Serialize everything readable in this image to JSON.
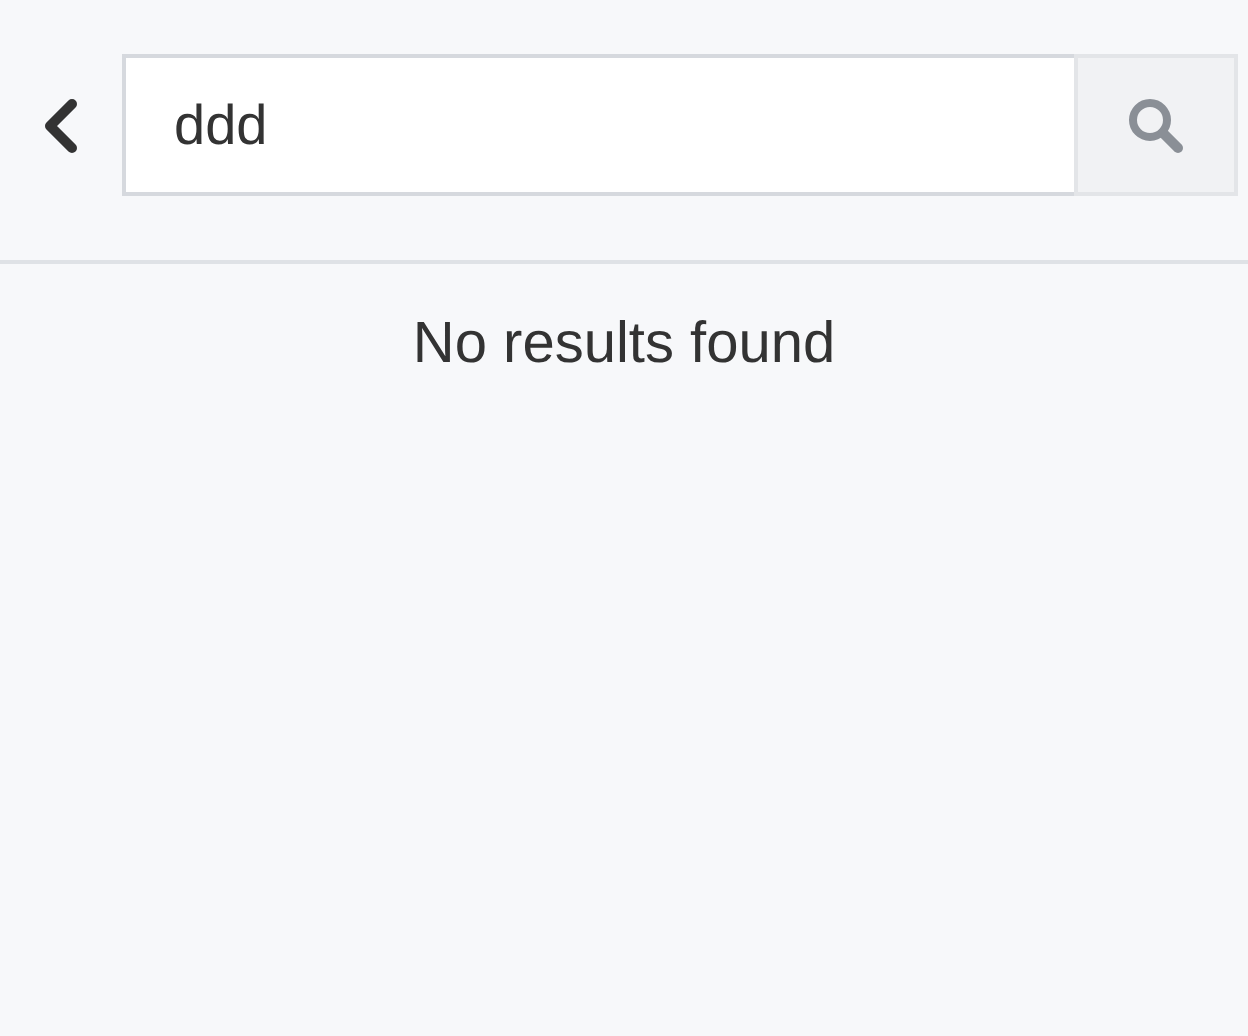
{
  "search": {
    "value": "ddd"
  },
  "message": "No results found"
}
